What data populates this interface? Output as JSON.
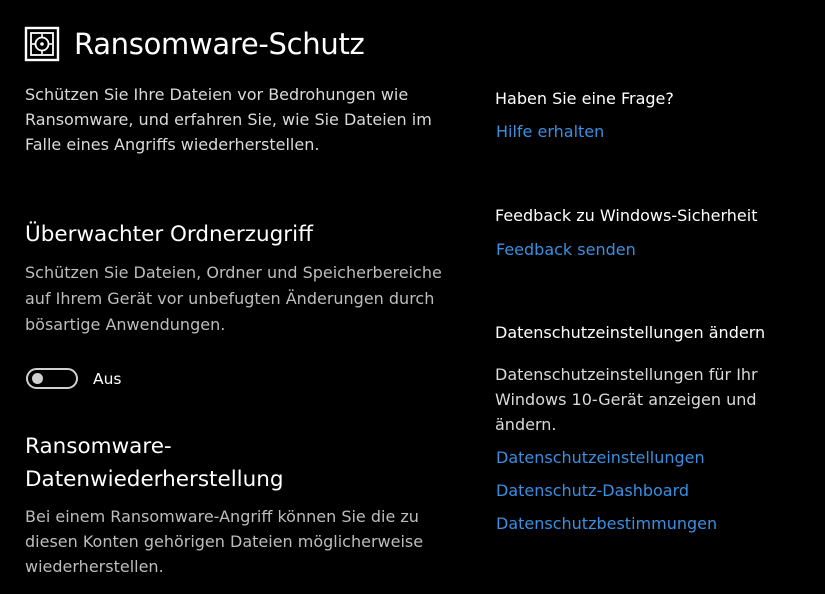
{
  "header": {
    "title": "Ransomware-Schutz",
    "icon": "ransomware-protection-icon"
  },
  "intro": "Schützen Sie Ihre Dateien vor Bedrohungen wie Ransomware, und erfahren Sie, wie Sie Dateien im Falle eines Angriffs wiederherstellen.",
  "controlled_folder_access": {
    "title": "Überwachter Ordnerzugriff",
    "description": "Schützen Sie Dateien, Ordner und Speicherbereiche auf Ihrem Gerät vor unbefugten Änderungen durch bösartige Anwendungen.",
    "toggle_state": "off",
    "toggle_label": "Aus"
  },
  "recovery": {
    "title": "Ransomware-Datenwiederherstellung",
    "description": "Bei einem Ransomware-Angriff können Sie die zu diesen Konten gehörigen Dateien möglicherweise wiederherstellen."
  },
  "sidebar": {
    "question_heading": "Haben Sie eine Frage?",
    "help_link": "Hilfe erhalten",
    "feedback_heading": "Feedback zu Windows-Sicherheit",
    "feedback_link": "Feedback senden",
    "privacy_heading": "Datenschutzeinstellungen ändern",
    "privacy_text": "Datenschutzeinstellungen für Ihr Windows 10-Gerät anzeigen und ändern.",
    "privacy_settings_link": "Datenschutzeinstellungen",
    "privacy_dashboard_link": "Datenschutz-Dashboard",
    "privacy_statement_link": "Datenschutzbestimmungen"
  },
  "colors": {
    "background": "#000000",
    "link": "#3a8fe0",
    "secondary_text": "#bdbdbd"
  }
}
